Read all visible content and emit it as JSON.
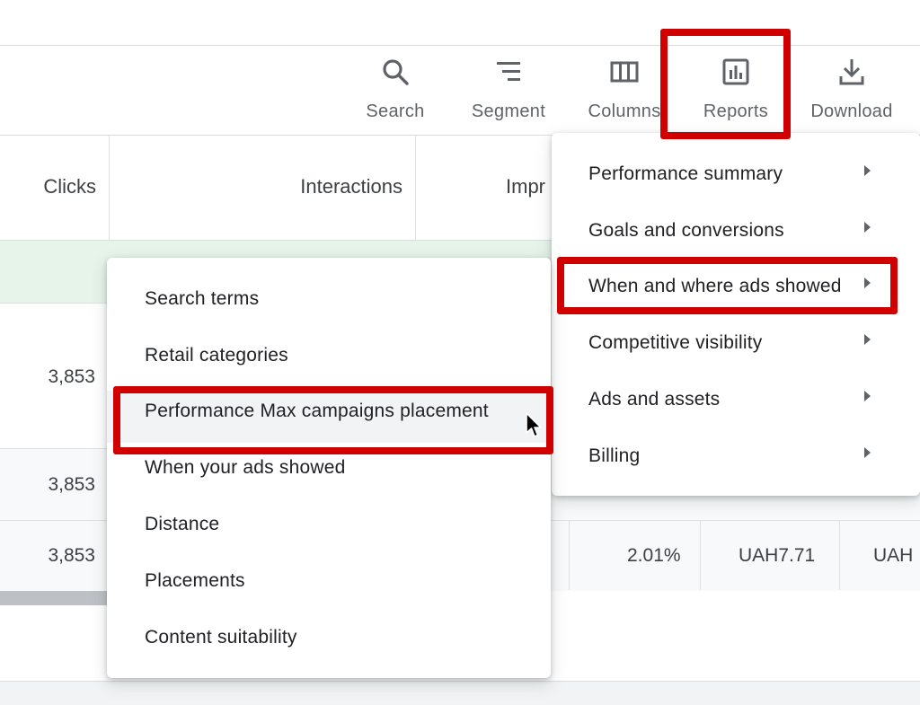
{
  "toolbar": {
    "search_label": "Search",
    "segment_label": "Segment",
    "columns_label": "Columns",
    "reports_label": "Reports",
    "download_label": "Download"
  },
  "table": {
    "headers": {
      "clicks": "Clicks",
      "interactions": "Interactions",
      "impressions_truncated": "Impr"
    },
    "rows": [
      {
        "clicks": "3,853"
      },
      {
        "clicks": "3,853"
      },
      {
        "clicks": "3,853",
        "truncated": "l",
        "ctr": "2.01%",
        "avg_cpc": "UAH7.71",
        "cost_truncated": "UAH"
      }
    ]
  },
  "reports_menu": {
    "items": [
      {
        "label": "Performance summary"
      },
      {
        "label": "Goals and conversions"
      },
      {
        "label": "When and where ads showed"
      },
      {
        "label": "Competitive visibility"
      },
      {
        "label": "Ads and assets"
      },
      {
        "label": "Billing"
      }
    ]
  },
  "submenu": {
    "items": [
      {
        "label": "Search terms"
      },
      {
        "label": "Retail categories"
      },
      {
        "label": "Performance Max campaigns placement"
      },
      {
        "label": "When your ads showed"
      },
      {
        "label": "Distance"
      },
      {
        "label": "Placements"
      },
      {
        "label": "Content suitability"
      }
    ]
  },
  "colors": {
    "highlight_red": "#d10000",
    "total_row_green": "#e6f4ea",
    "icon_gray": "#5f6368"
  }
}
